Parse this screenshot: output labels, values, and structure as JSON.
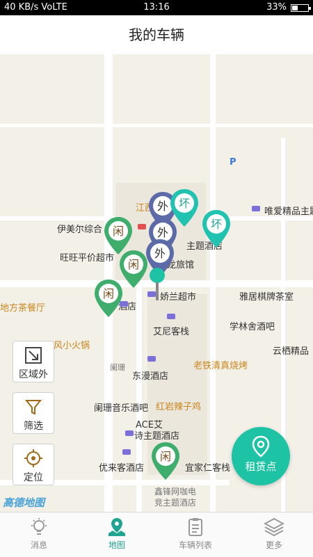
{
  "status_bar": {
    "left": "40 KB/s VoLTE",
    "time": "13:16",
    "battery": "33%"
  },
  "header": {
    "title": "我的车辆"
  },
  "map": {
    "labels": [
      {
        "text": "江西",
        "style": "orange"
      },
      {
        "text": "伊美尔综合",
        "style": "dark"
      },
      {
        "text": "旺旺平价超市",
        "style": "dark"
      },
      {
        "text": "主题酒店",
        "style": "dark"
      },
      {
        "text": "龙旅馆",
        "style": "dark"
      },
      {
        "text": "唯爱精品主题",
        "style": "dark"
      },
      {
        "text": "娇兰超市",
        "style": "dark"
      },
      {
        "text": "雅居棋牌茶室",
        "style": "dark"
      },
      {
        "text": "酒店",
        "style": "dark"
      },
      {
        "text": "地方茶餐厅",
        "style": "orange"
      },
      {
        "text": "艾尼客栈",
        "style": "dark"
      },
      {
        "text": "学林舍酒吧",
        "style": "dark"
      },
      {
        "text": "顺风小火锅",
        "style": "orange"
      },
      {
        "text": "云栖精品",
        "style": "dark"
      },
      {
        "text": "老铁清真烧烤",
        "style": "orange"
      },
      {
        "text": "阑珊",
        "style": "dark"
      },
      {
        "text": "东漫酒店",
        "style": "dark"
      },
      {
        "text": "阑珊音乐酒吧",
        "style": "dark"
      },
      {
        "text": "红岩辣子鸡",
        "style": "orange"
      },
      {
        "text": "ACE艾",
        "style": "dark"
      },
      {
        "text": "诗主题酒店",
        "style": "dark"
      },
      {
        "text": "优来客酒店",
        "style": "dark"
      },
      {
        "text": "宜家仁客栈",
        "style": "dark"
      },
      {
        "text": "鑫锋网咖电",
        "style": "dark"
      },
      {
        "text": "竞主题酒店",
        "style": "dark"
      }
    ],
    "parking_label": "P",
    "pins": [
      {
        "label": "外",
        "kind": "out"
      },
      {
        "label": "外",
        "kind": "out"
      },
      {
        "label": "外",
        "kind": "out"
      },
      {
        "label": "坏",
        "kind": "broken"
      },
      {
        "label": "坏",
        "kind": "broken"
      },
      {
        "label": "闲",
        "kind": "idle"
      },
      {
        "label": "闲",
        "kind": "idle"
      },
      {
        "label": "闲",
        "kind": "idle"
      },
      {
        "label": "闲",
        "kind": "idle"
      }
    ],
    "logo": "高德地图"
  },
  "controls": {
    "out_of_area": "区域外",
    "filter": "筛选",
    "locate": "定位"
  },
  "fab": {
    "label": "租赁点"
  },
  "tabs": [
    {
      "label": "消息",
      "active": false
    },
    {
      "label": "地图",
      "active": true
    },
    {
      "label": "车辆列表",
      "active": false
    },
    {
      "label": "更多",
      "active": false
    }
  ],
  "colors": {
    "accent": "#1ec3a6",
    "out_pin": "#5c6aa8",
    "broken_pin": "#22c2b0",
    "idle_pin": "#3fae6d"
  }
}
